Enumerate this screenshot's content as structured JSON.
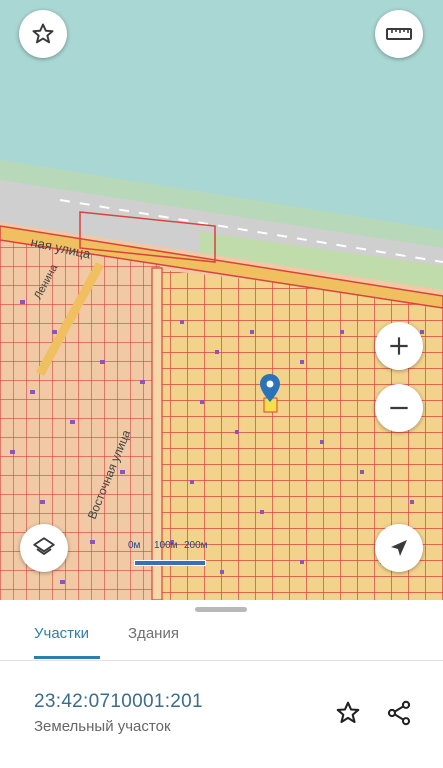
{
  "map": {
    "street_labels": [
      "ная улица",
      "Ленина",
      "Восточная улица"
    ],
    "scale": {
      "zero": "0м",
      "mid": "100м",
      "end": "200м"
    },
    "colors": {
      "water": "#a9d7d3",
      "parcel_fill": "#f3d38c",
      "parcel_line": "#d9423f",
      "road": "#f0c060",
      "building": "#8c55b8",
      "marker": "#2a73b8"
    }
  },
  "controls": {
    "favorite_icon": "star-outline-icon",
    "ruler_icon": "ruler-icon",
    "zoom_in_icon": "plus-icon",
    "zoom_out_icon": "minus-icon",
    "layers_icon": "layers-icon",
    "locate_icon": "navigation-arrow-icon"
  },
  "sheet": {
    "tabs": [
      {
        "label": "Участки",
        "active": true
      },
      {
        "label": "Здания",
        "active": false
      }
    ],
    "parcel": {
      "cadastral_number": "23:42:0710001:201",
      "type": "Земельный участок"
    },
    "actions": {
      "favorite_icon": "star-outline-icon",
      "share_icon": "share-icon"
    }
  }
}
